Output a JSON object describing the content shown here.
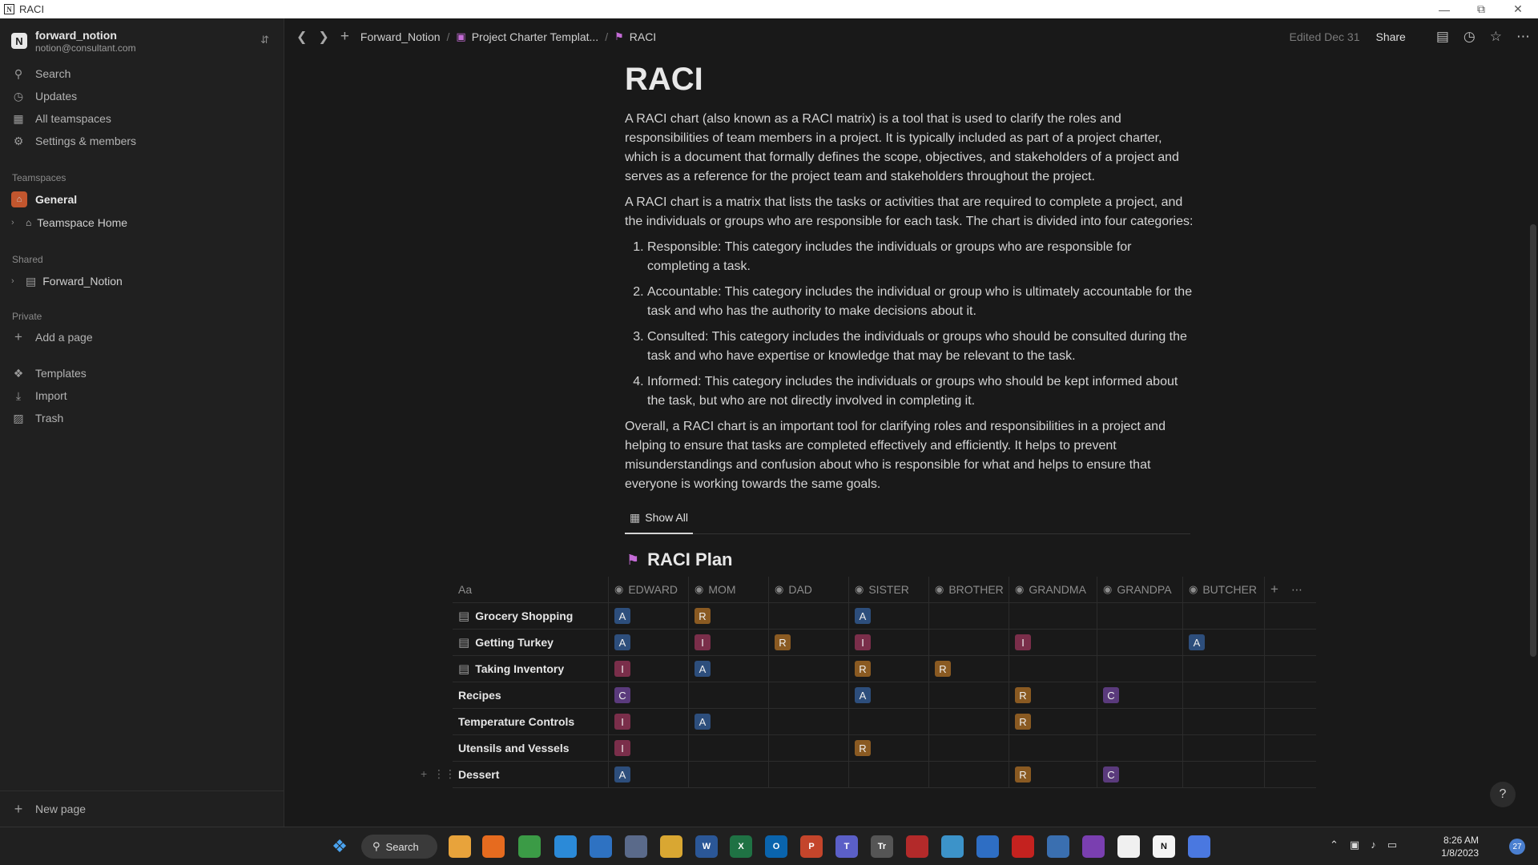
{
  "window": {
    "title": "RACI"
  },
  "sidebar": {
    "workspace_name": "forward_notion",
    "workspace_email": "notion@consultant.com",
    "nav": [
      {
        "label": "Search",
        "icon": "search-icon"
      },
      {
        "label": "Updates",
        "icon": "clock-icon"
      },
      {
        "label": "All teamspaces",
        "icon": "grid-icon"
      },
      {
        "label": "Settings & members",
        "icon": "gear-icon"
      }
    ],
    "teamspaces_label": "Teamspaces",
    "teamspace_general": "General",
    "teamspace_home": "Teamspace Home",
    "shared_label": "Shared",
    "shared_item": "Forward_Notion",
    "private_label": "Private",
    "add_page": "Add a page",
    "bottom_nav": [
      {
        "label": "Templates",
        "icon": "templates-icon"
      },
      {
        "label": "Import",
        "icon": "import-icon"
      },
      {
        "label": "Trash",
        "icon": "trash-icon"
      }
    ],
    "new_page": "New page"
  },
  "topbar": {
    "breadcrumb": [
      "Forward_Notion",
      "Project Charter Templat...",
      "RACI"
    ],
    "edited": "Edited Dec 31",
    "share": "Share"
  },
  "page": {
    "title": "RACI",
    "p1": "A RACI chart (also known as a RACI matrix) is a tool that is used to clarify the roles and responsibilities of team members in a project. It is typically included as part of a project charter, which is a document that formally defines the scope, objectives, and stakeholders of a project and serves as a reference for the project team and stakeholders throughout the project.",
    "p2": "A RACI chart is a matrix that lists the tasks or activities that are required to complete a project, and the individuals or groups who are responsible for each task. The chart is divided into four categories:",
    "list": [
      "Responsible: This category includes the individuals or groups who are responsible for completing a task.",
      "Accountable: This category includes the individual or group who is ultimately accountable for the task and who has the authority to make decisions about it.",
      "Consulted: This category includes the individuals or groups who should be consulted during the task and who have expertise or knowledge that may be relevant to the task.",
      "Informed: This category includes the individuals or groups who should be kept informed about the task, but who are not directly involved in completing it."
    ],
    "p3": "Overall, a RACI chart is an important tool for clarifying roles and responsibilities in a project and helping to ensure that tasks are completed effectively and efficiently. It helps to prevent misunderstandings and confusion about who is responsible for what and helps to ensure that everyone is working towards the same goals.",
    "view_tab": "Show All"
  },
  "database": {
    "title": "RACI Plan",
    "name_header": "Aa",
    "columns": [
      "EDWARD",
      "MOM",
      "DAD",
      "SISTER",
      "BROTHER",
      "GRANDMA",
      "GRANDPA",
      "BUTCHER"
    ],
    "rows": [
      {
        "name": "Grocery Shopping",
        "doc": true,
        "cells": [
          "A",
          "R",
          "",
          "A",
          "",
          "",
          "",
          ""
        ]
      },
      {
        "name": "Getting Turkey",
        "doc": true,
        "cells": [
          "A",
          "I",
          "R",
          "I",
          "",
          "I",
          "",
          "A"
        ]
      },
      {
        "name": "Taking Inventory",
        "doc": true,
        "cells": [
          "I",
          "A",
          "",
          "R",
          "R",
          "",
          "",
          ""
        ]
      },
      {
        "name": "Recipes",
        "doc": false,
        "cells": [
          "C",
          "",
          "",
          "A",
          "",
          "R",
          "C",
          ""
        ]
      },
      {
        "name": "Temperature Controls",
        "doc": false,
        "cells": [
          "I",
          "A",
          "",
          "",
          "",
          "R",
          "",
          ""
        ]
      },
      {
        "name": "Utensils and Vessels",
        "doc": false,
        "cells": [
          "I",
          "",
          "",
          "R",
          "",
          "",
          "",
          ""
        ]
      },
      {
        "name": "Dessert",
        "doc": false,
        "cells": [
          "A",
          "",
          "",
          "",
          "",
          "R",
          "C",
          ""
        ]
      }
    ]
  },
  "taskbar": {
    "search": "Search",
    "time": "8:26 AM",
    "date": "1/8/2023",
    "notifications": "27"
  }
}
